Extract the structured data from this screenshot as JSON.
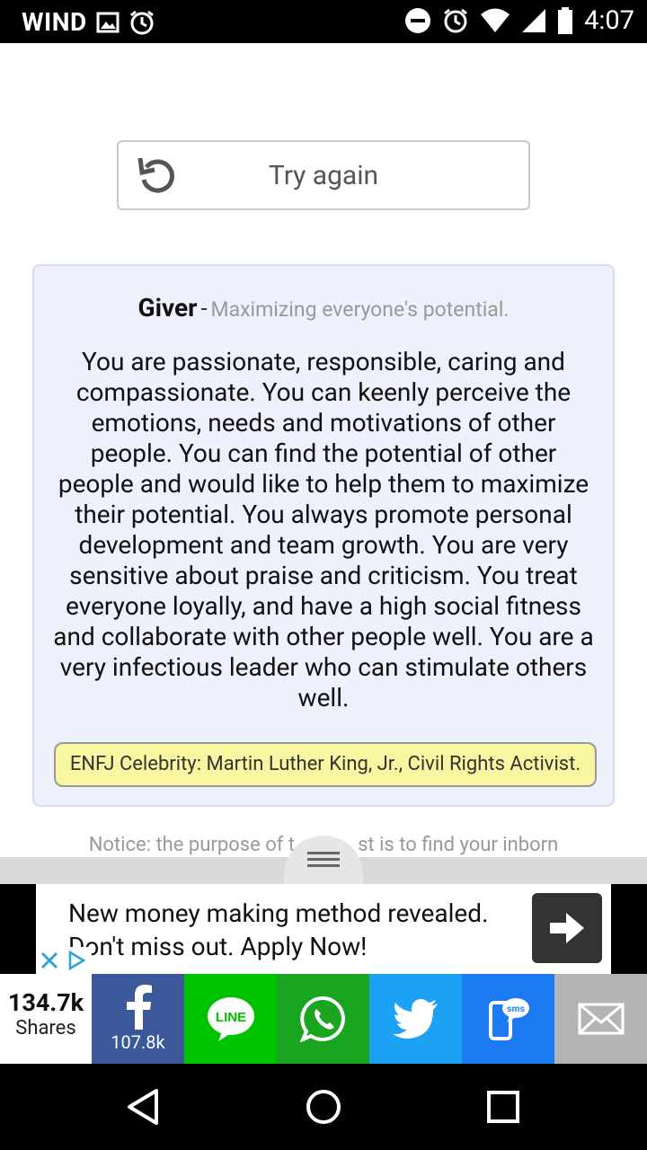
{
  "status_bar": {
    "carrier": "WIND",
    "time": "4:07",
    "icons": [
      "image-icon",
      "alarm-icon",
      "do-not-disturb-icon",
      "alarm-icon",
      "wifi-icon",
      "signal-icon",
      "battery-icon"
    ]
  },
  "try_again": {
    "label": "Try again",
    "icon": "refresh-icon"
  },
  "result": {
    "type": "Giver",
    "separator": "-",
    "tagline": "Maximizing everyone's potential.",
    "description": "You are passionate, responsible, caring and compassionate. You can keenly perceive the emotions, needs and motivations of other people. You can find the potential of other people and would like to help them to maximize their potential. You always promote personal development and team growth. You are very sensitive about praise and criticism. You treat everyone loyally, and have a high social fitness and collaborate with other people well. You are a very infectious leader who can stimulate others well.",
    "celebrity": "ENFJ Celebrity: Martin Luther King, Jr., Civil Rights Activist."
  },
  "notice": {
    "before": "Notice: the purpose of t",
    "after": "st is to find your inborn"
  },
  "ad": {
    "text": "New money making method revealed. Don't miss out. Apply Now!",
    "arrow_icon": "arrow-right-icon",
    "close_icons": [
      "close-icon",
      "adchoices-icon"
    ]
  },
  "share": {
    "total": "134.7k",
    "total_label": "Shares",
    "buttons": [
      {
        "name": "facebook",
        "icon": "facebook-icon",
        "count": "107.8k",
        "color": "#3b5998"
      },
      {
        "name": "line",
        "icon": "line-icon",
        "color": "#00c300"
      },
      {
        "name": "whatsapp",
        "icon": "whatsapp-icon",
        "color": "#1aa520"
      },
      {
        "name": "twitter",
        "icon": "twitter-icon",
        "color": "#1da1f2"
      },
      {
        "name": "sms",
        "icon": "sms-icon",
        "color": "#1d7bf2"
      },
      {
        "name": "email",
        "icon": "email-icon",
        "color": "#b4b4b4"
      }
    ]
  },
  "nav_bar": {
    "icons": [
      "back-icon",
      "home-icon",
      "recents-icon"
    ]
  }
}
